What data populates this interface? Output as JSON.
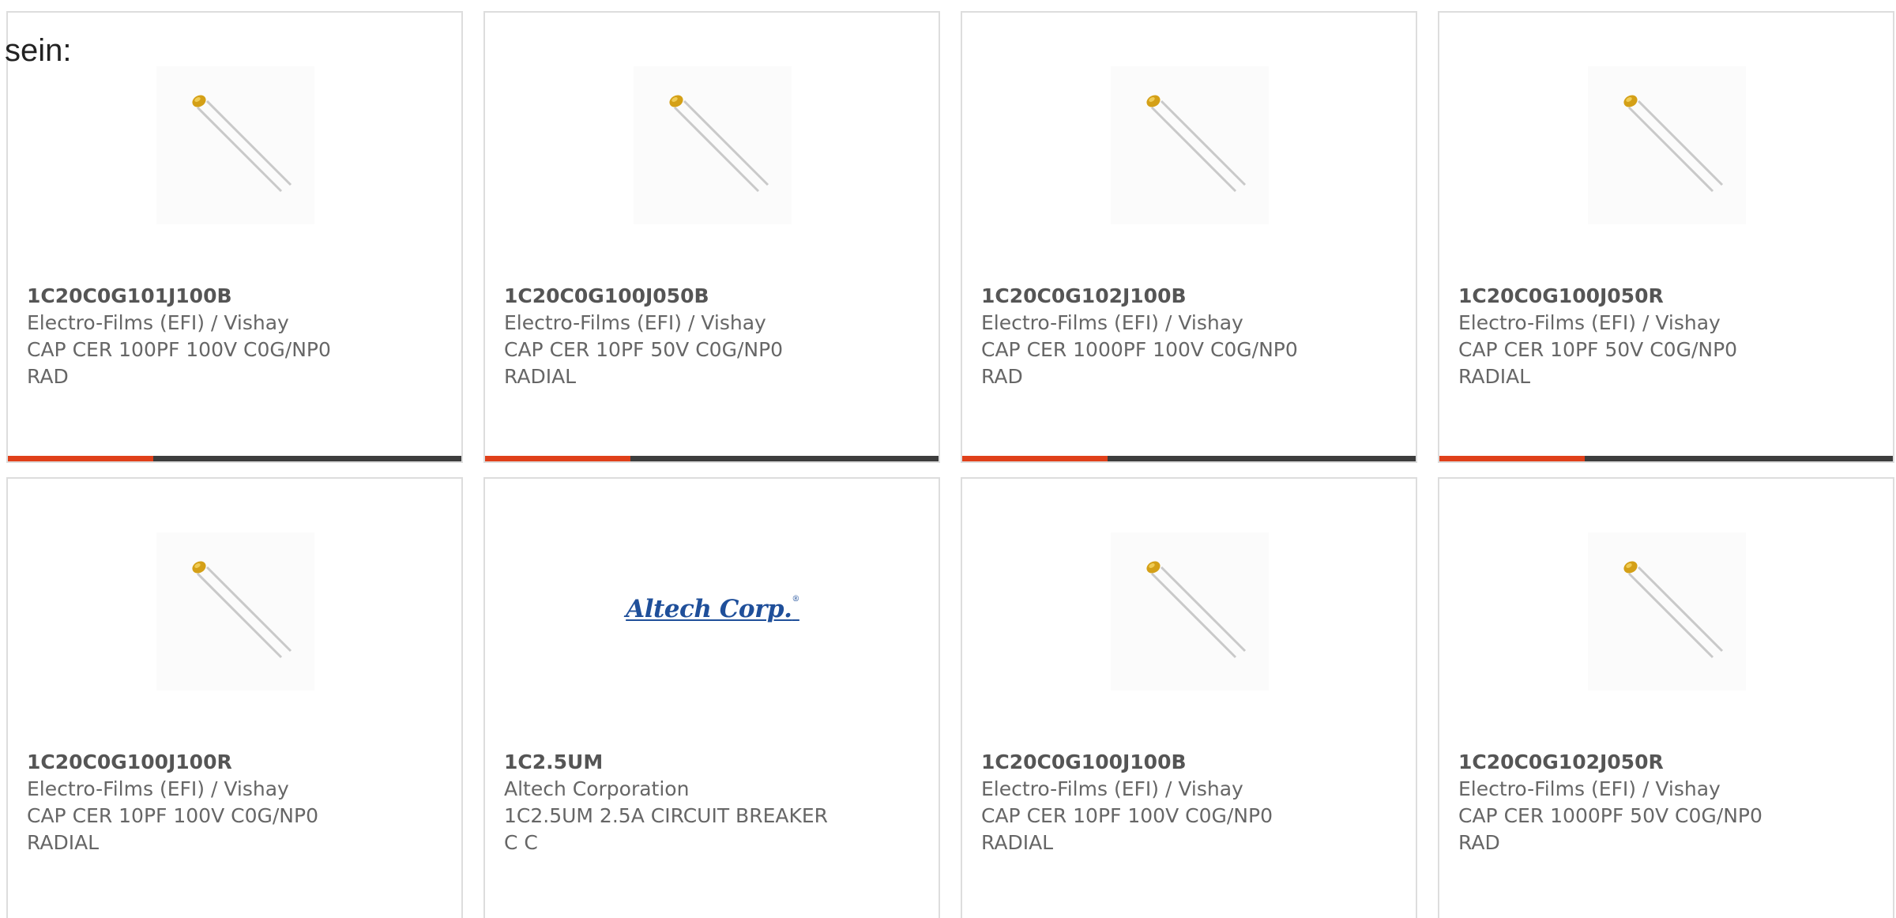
{
  "intro_text": "sein:",
  "colors": {
    "accent": "#e0401a",
    "bar_track": "#3d3d3d",
    "card_border": "#dddddd",
    "text": "#666666",
    "logo_blue": "#1f4f9a"
  },
  "products": [
    {
      "part_number": "1C20C0G101J100B",
      "manufacturer": "Electro-Films (EFI) / Vishay",
      "desc_line1": "CAP CER 100PF 100V C0G/NP0",
      "desc_line2": "RAD",
      "image": "ceramic-capacitor-image",
      "progress": 0.32
    },
    {
      "part_number": "1C20C0G100J050B",
      "manufacturer": "Electro-Films (EFI) / Vishay",
      "desc_line1": "CAP CER 10PF 50V C0G/NP0",
      "desc_line2": "RADIAL",
      "image": "ceramic-capacitor-image",
      "progress": 0.32
    },
    {
      "part_number": "1C20C0G102J100B",
      "manufacturer": "Electro-Films (EFI) / Vishay",
      "desc_line1": "CAP CER 1000PF 100V C0G/NP0",
      "desc_line2": "RAD",
      "image": "ceramic-capacitor-image",
      "progress": 0.32
    },
    {
      "part_number": "1C20C0G100J050R",
      "manufacturer": "Electro-Films (EFI) / Vishay",
      "desc_line1": "CAP CER 10PF 50V C0G/NP0",
      "desc_line2": "RADIAL",
      "image": "ceramic-capacitor-image",
      "progress": 0.32
    },
    {
      "part_number": "1C20C0G100J100R",
      "manufacturer": "Electro-Films (EFI) / Vishay",
      "desc_line1": "CAP CER 10PF 100V C0G/NP0",
      "desc_line2": "RADIAL",
      "image": "ceramic-capacitor-image"
    },
    {
      "part_number": "1C2.5UM",
      "manufacturer": "Altech Corporation",
      "desc_line1": "1C2.5UM 2.5A CIRCUIT BREAKER",
      "desc_line2": "C C",
      "image": "altech-logo",
      "logo_text": "Altech Corp."
    },
    {
      "part_number": "1C20C0G100J100B",
      "manufacturer": "Electro-Films (EFI) / Vishay",
      "desc_line1": "CAP CER 10PF 100V C0G/NP0",
      "desc_line2": "RADIAL",
      "image": "ceramic-capacitor-image"
    },
    {
      "part_number": "1C20C0G102J050R",
      "manufacturer": "Electro-Films (EFI) / Vishay",
      "desc_line1": "CAP CER 1000PF 50V C0G/NP0",
      "desc_line2": "RAD",
      "image": "ceramic-capacitor-image"
    }
  ]
}
